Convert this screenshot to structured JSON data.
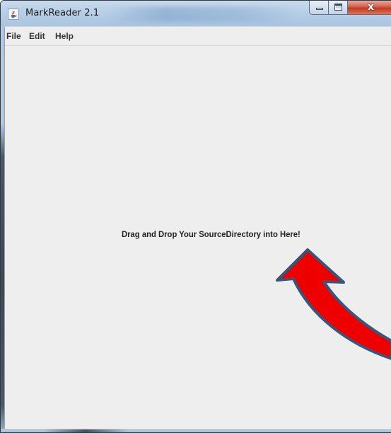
{
  "window": {
    "title": "MarkReader 2.1",
    "close_glyph": "x",
    "accent_close_color": "#c43a21",
    "titlebar_color": "#b8cfe7"
  },
  "icons": {
    "app": "java-cup-icon",
    "minimize": "minimize-icon",
    "maximize": "maximize-icon",
    "close": "close-icon",
    "arrow": "curved-arrow-pointer"
  },
  "menu": {
    "items": [
      {
        "label": "File"
      },
      {
        "label": "Edit"
      },
      {
        "label": "Help"
      }
    ]
  },
  "main": {
    "drop_label": "Drag and Drop Your SourceDirectory into Here!",
    "background_color": "#eeeeee",
    "arrow_fill_color": "#ee0000",
    "arrow_outline_color": "#3a5578"
  }
}
